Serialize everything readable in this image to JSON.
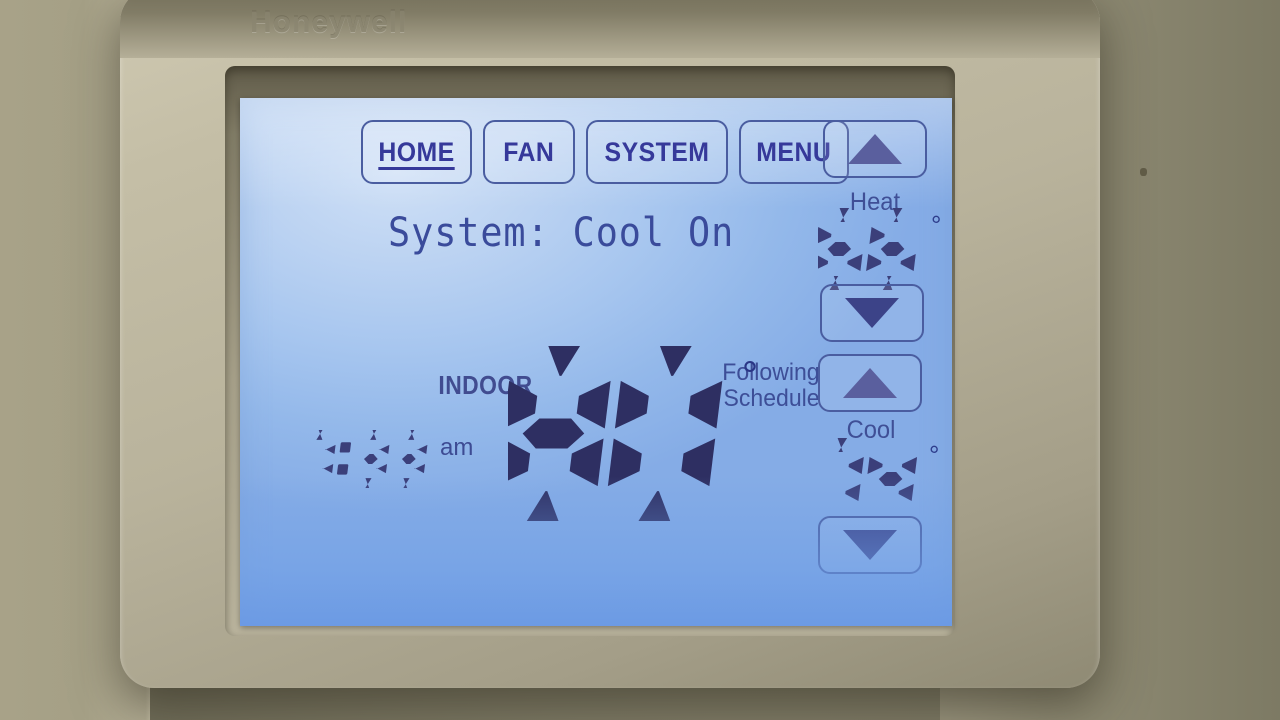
{
  "device": {
    "brand": "Honeywell",
    "screen_type": "touchscreen-thermostat-lcd"
  },
  "nav": {
    "items": [
      {
        "id": "home",
        "label": "HOME",
        "active": true
      },
      {
        "id": "fan",
        "label": "FAN",
        "active": false
      },
      {
        "id": "system",
        "label": "SYSTEM",
        "active": false
      },
      {
        "id": "menu",
        "label": "MENU",
        "active": false
      }
    ]
  },
  "status": {
    "system_line": "System: Cool On",
    "schedule_line_1": "Following",
    "schedule_line_2": "Schedule"
  },
  "indoor": {
    "label": "INDOOR",
    "temperature": "80",
    "degree": "°"
  },
  "clock": {
    "time": "7:33",
    "meridiem": "am"
  },
  "setpoints": {
    "heat": {
      "label": "Heat",
      "value": "66",
      "degree": "°",
      "up_icon": "triangle-up-icon",
      "down_icon": "triangle-down-icon"
    },
    "cool": {
      "label": "Cool",
      "value": "74",
      "degree": "°",
      "up_icon": "triangle-up-icon",
      "down_icon": "triangle-down-icon"
    }
  },
  "colors": {
    "lcd_backlight": "#a7c6ef",
    "lcd_ink": "#2f3f8e",
    "segment_ink": "#3b3f7a",
    "bezel": "#b9b39c",
    "wall": "#8e8a74"
  }
}
